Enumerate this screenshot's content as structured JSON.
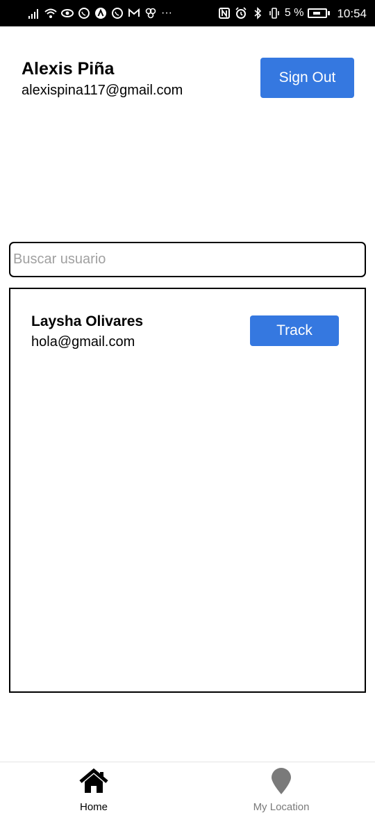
{
  "status_bar": {
    "left_icons": [
      "signal-icon",
      "wifi-icon",
      "eye-icon",
      "whatsapp-icon",
      "app-a-icon",
      "whatsapp-icon",
      "gmail-icon",
      "pinwheel-icon",
      "more-icon"
    ],
    "more_text": "···",
    "right_icons": [
      "nfc-icon",
      "alarm-icon",
      "bluetooth-icon",
      "vibrate-icon"
    ],
    "battery_text": "5 %",
    "time": "10:54"
  },
  "profile": {
    "name": "Alexis Piña",
    "email": "alexispina117@gmail.com",
    "sign_out_label": "Sign Out"
  },
  "search": {
    "placeholder": "Buscar usuario",
    "value": ""
  },
  "users": [
    {
      "name": "Laysha Olivares",
      "email": "hola@gmail.com",
      "action_label": "Track"
    }
  ],
  "tabs": [
    {
      "label": "Home",
      "icon": "home-icon",
      "active": true
    },
    {
      "label": "My Location",
      "icon": "location-pin-icon",
      "active": false
    }
  ],
  "colors": {
    "primary": "#3578e0",
    "status_bar_bg": "#000000",
    "tab_inactive": "#7a7a7a",
    "placeholder": "#a0a0a0"
  }
}
